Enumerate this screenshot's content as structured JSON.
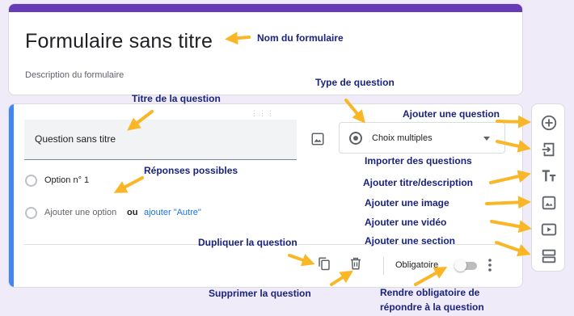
{
  "form": {
    "title": "Formulaire sans titre",
    "description_placeholder": "Description du formulaire"
  },
  "question": {
    "drag_handle": "⋮⋮⋮",
    "title": "Question sans titre",
    "type": "Choix multiples",
    "options": [
      "Option n° 1"
    ],
    "add_option": "Ajouter une option",
    "or": "ou",
    "add_other": "ajouter \"Autre\"",
    "required_label": "Obligatoire",
    "required": false
  },
  "side_toolbar": {
    "icons": [
      "add-circle-icon",
      "import-icon",
      "title-text-icon",
      "image-icon",
      "video-icon",
      "section-icon"
    ]
  },
  "annotations": {
    "form_name": "Nom du formulaire",
    "question_type": "Type de question",
    "question_title": "Titre de la question",
    "add_question": "Ajouter une question",
    "import_questions": "Importer des questions",
    "add_title_desc": "Ajouter titre/description",
    "possible_answers": "Réponses possibles",
    "add_image": "Ajouter une image",
    "add_video": "Ajouter une vidéo",
    "add_section": "Ajouter une section",
    "duplicate": "Dupliquer la question",
    "delete": "Supprimer la question",
    "required_line1": "Rendre obligatoire de",
    "required_line2": "répondre à la question"
  },
  "colors": {
    "theme": "#673ab7",
    "active_bar": "#4285f4",
    "background": "#f0ebf8",
    "link": "#1a73e8",
    "arrow": "#f9b626",
    "annotation_text": "#1a237e"
  }
}
